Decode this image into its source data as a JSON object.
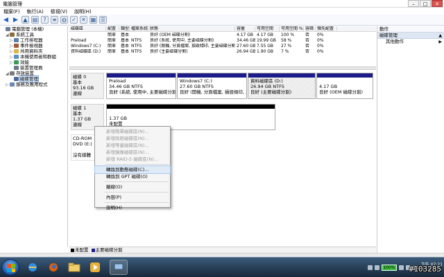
{
  "window": {
    "title": "電腦管理",
    "min": "–",
    "max": "□",
    "close": "✕"
  },
  "menu": [
    "檔案(F)",
    "執行(A)",
    "檢視(V)",
    "說明(H)"
  ],
  "tree": [
    {
      "label": "電腦管理 (本機)",
      "indent": 0,
      "exp": "",
      "color": "#6b7f99"
    },
    {
      "label": "系統工具",
      "indent": 1,
      "exp": "◢",
      "color": "#8a6d3b"
    },
    {
      "label": "工作排程器",
      "indent": 2,
      "exp": "▷",
      "color": "#5a7fa8"
    },
    {
      "label": "事件檢視器",
      "indent": 2,
      "exp": "▷",
      "color": "#a35a3a"
    },
    {
      "label": "共用資料夾",
      "indent": 2,
      "exp": "▷",
      "color": "#d9b44a"
    },
    {
      "label": "本機使用者和群組",
      "indent": 2,
      "exp": "▷",
      "color": "#5a8fbf"
    },
    {
      "label": "效能",
      "indent": 2,
      "exp": "▷",
      "color": "#3a9a5a"
    },
    {
      "label": "裝置管理員",
      "indent": 2,
      "exp": "",
      "color": "#6a7a8a"
    },
    {
      "label": "存放裝置",
      "indent": 1,
      "exp": "◢",
      "color": "#7a7a7a"
    },
    {
      "label": "磁碟管理",
      "indent": 2,
      "exp": "",
      "color": "#4a6a9a",
      "selected": true
    },
    {
      "label": "服務及應用程式",
      "indent": 1,
      "exp": "▷",
      "color": "#6a8ab0"
    }
  ],
  "volume_table": {
    "headers": [
      "磁碟區",
      "配置",
      "類型",
      "檔案系統",
      "狀態",
      "容量",
      "可用空間",
      "可用空間 %",
      "容錯",
      "預先配置"
    ],
    "rows": [
      [
        "",
        "簡單",
        "基本",
        "",
        "良好 (OEM 磁碟分割)",
        "4.17 GB",
        "4.17 GB",
        "100 %",
        "否",
        "0%"
      ],
      [
        "Preload",
        "簡單",
        "基本",
        "NTFS",
        "良好 (系統, 使用中, 主要磁碟分割)",
        "34.46 GB",
        "19.99 GB",
        "58 %",
        "否",
        "0%"
      ],
      [
        "Windows7 (C:)",
        "簡單",
        "基本",
        "NTFS",
        "良好 (開機, 分頁檔案, 損毀傾印, 主要磁碟分割)",
        "27.60 GB",
        "7.55 GB",
        "27 %",
        "否",
        "0%"
      ],
      [
        "資料磁碟區 (D:)",
        "簡單",
        "基本",
        "NTFS",
        "良好 (主要磁碟分割)",
        "26.94 GB",
        "1.90 GB",
        "7 %",
        "否",
        "0%"
      ]
    ]
  },
  "disk0": {
    "label": [
      "磁碟 0",
      "基本",
      "93.16 GB",
      "連線"
    ],
    "partitions": [
      {
        "name": "Preload",
        "size": "34.46 GB NTFS",
        "status": "良好 (系統, 使用中, 主要磁碟分割)"
      },
      {
        "name": "Windows7 (C:)",
        "size": "27.60 GB NTFS",
        "status": "良好 (開機, 分頁檔案, 損毀傾印, 主要"
      },
      {
        "name": "資料磁碟區 (D:)",
        "size": "26.94 GB NTFS",
        "status": "良好 (主要磁碟分割)"
      },
      {
        "name": "",
        "size": "4.17 GB",
        "status": "良好 (OEM 磁碟分割)"
      }
    ]
  },
  "disk1": {
    "label": [
      "磁碟 1",
      "基本",
      "1.37 GB",
      "連線"
    ],
    "partition": {
      "size": "1.37 GB",
      "status": "未配置"
    }
  },
  "cdrom": {
    "label": [
      "CD-ROM",
      "DVD (E:)",
      "",
      "沒有媒體"
    ]
  },
  "legend": [
    {
      "color": "#000000",
      "text": "未配置"
    },
    {
      "color": "#1b1b8a",
      "text": "主要磁碟分割"
    }
  ],
  "context_menu": [
    {
      "label": "新增簡單磁碟區(N)...",
      "disabled": true
    },
    {
      "label": "新增跨距磁碟區(N)...",
      "disabled": true
    },
    {
      "label": "新增等量磁碟區(N)...",
      "disabled": true
    },
    {
      "label": "新增鏡像磁碟區(N)...",
      "disabled": true
    },
    {
      "label": "新增 RAID-5 磁碟區(N)...",
      "disabled": true
    },
    {
      "sep": true
    },
    {
      "label": "轉換到動態磁碟(C)...",
      "highlight": true
    },
    {
      "label": "轉換到 GPT 磁碟(O)"
    },
    {
      "sep": true
    },
    {
      "label": "離線(O)"
    },
    {
      "sep": true
    },
    {
      "label": "內容(P)"
    },
    {
      "sep": true
    },
    {
      "label": "說明(H)"
    }
  ],
  "actions": {
    "header": "動作",
    "section": "磁碟管理",
    "item": "其他動作"
  },
  "tray": {
    "battery": "100%",
    "clock_time": "下午 07:21",
    "clock_date": "2010/2/1"
  },
  "watermark": "#103285"
}
